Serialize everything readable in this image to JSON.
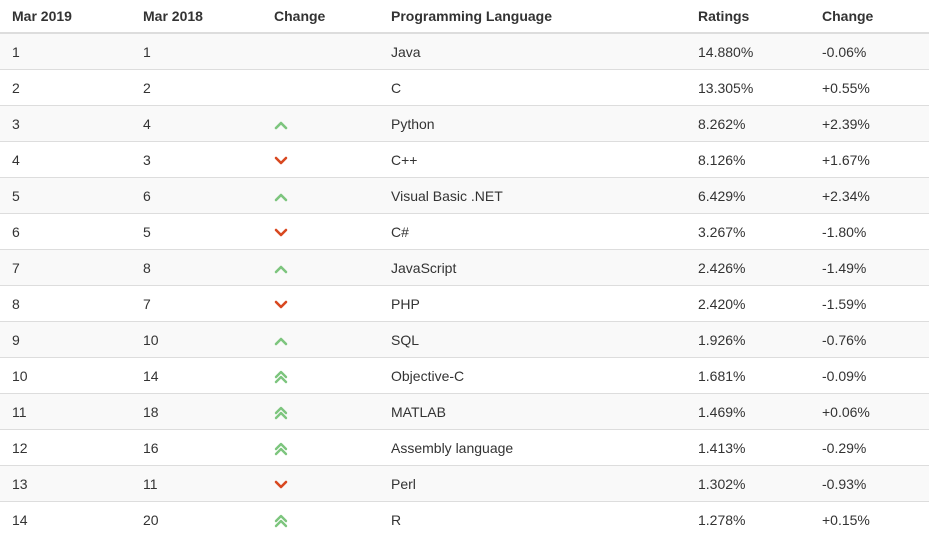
{
  "colors": {
    "up": "#7dc57e",
    "down": "#d84820",
    "header_border": "#dddddd",
    "stripe": "#f9f9f9"
  },
  "table": {
    "headers": [
      "Mar 2019",
      "Mar 2018",
      "Change",
      "Programming Language",
      "Ratings",
      "Change"
    ],
    "rows": [
      {
        "rank_2019": "1",
        "rank_2018": "1",
        "change_icon": "none",
        "language": "Java",
        "rating": "14.880%",
        "rating_change": "-0.06%"
      },
      {
        "rank_2019": "2",
        "rank_2018": "2",
        "change_icon": "none",
        "language": "C",
        "rating": "13.305%",
        "rating_change": "+0.55%"
      },
      {
        "rank_2019": "3",
        "rank_2018": "4",
        "change_icon": "up-icon",
        "language": "Python",
        "rating": "8.262%",
        "rating_change": "+2.39%"
      },
      {
        "rank_2019": "4",
        "rank_2018": "3",
        "change_icon": "down-icon",
        "language": "C++",
        "rating": "8.126%",
        "rating_change": "+1.67%"
      },
      {
        "rank_2019": "5",
        "rank_2018": "6",
        "change_icon": "up-icon",
        "language": "Visual Basic .NET",
        "rating": "6.429%",
        "rating_change": "+2.34%"
      },
      {
        "rank_2019": "6",
        "rank_2018": "5",
        "change_icon": "down-icon",
        "language": "C#",
        "rating": "3.267%",
        "rating_change": "-1.80%"
      },
      {
        "rank_2019": "7",
        "rank_2018": "8",
        "change_icon": "up-icon",
        "language": "JavaScript",
        "rating": "2.426%",
        "rating_change": "-1.49%"
      },
      {
        "rank_2019": "8",
        "rank_2018": "7",
        "change_icon": "down-icon",
        "language": "PHP",
        "rating": "2.420%",
        "rating_change": "-1.59%"
      },
      {
        "rank_2019": "9",
        "rank_2018": "10",
        "change_icon": "up-icon",
        "language": "SQL",
        "rating": "1.926%",
        "rating_change": "-0.76%"
      },
      {
        "rank_2019": "10",
        "rank_2018": "14",
        "change_icon": "double-up-icon",
        "language": "Objective-C",
        "rating": "1.681%",
        "rating_change": "-0.09%"
      },
      {
        "rank_2019": "11",
        "rank_2018": "18",
        "change_icon": "double-up-icon",
        "language": "MATLAB",
        "rating": "1.469%",
        "rating_change": "+0.06%"
      },
      {
        "rank_2019": "12",
        "rank_2018": "16",
        "change_icon": "double-up-icon",
        "language": "Assembly language",
        "rating": "1.413%",
        "rating_change": "-0.29%"
      },
      {
        "rank_2019": "13",
        "rank_2018": "11",
        "change_icon": "down-icon",
        "language": "Perl",
        "rating": "1.302%",
        "rating_change": "-0.93%"
      },
      {
        "rank_2019": "14",
        "rank_2018": "20",
        "change_icon": "double-up-icon",
        "language": "R",
        "rating": "1.278%",
        "rating_change": "+0.15%"
      }
    ]
  }
}
